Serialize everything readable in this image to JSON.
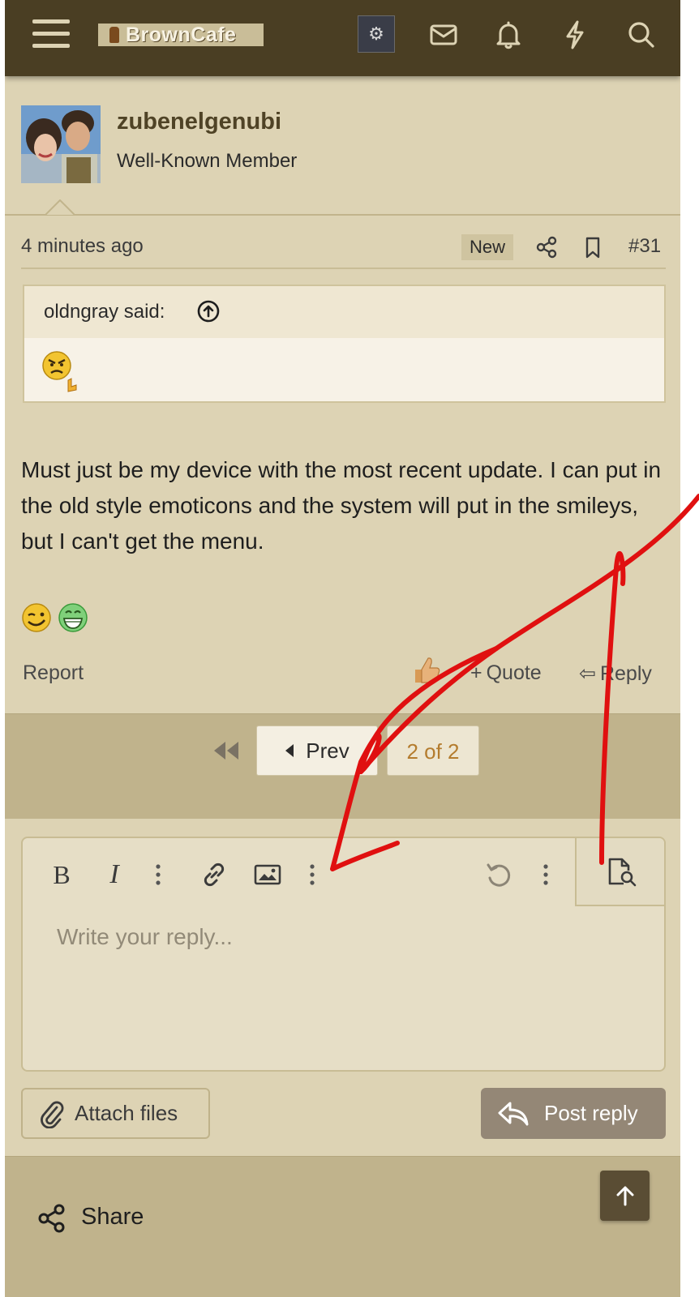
{
  "header": {
    "site_name": "BrownCafe",
    "icons": [
      "menu-icon",
      "inbox-icon",
      "bell-icon",
      "lightning-icon",
      "search-icon"
    ]
  },
  "post": {
    "username": "zubenelgenubi",
    "user_title": "Well-Known Member",
    "time": "4 minutes ago",
    "new_badge": "New",
    "post_number": "#31",
    "quote": {
      "author": "oldngray said:"
    },
    "body": "Must just be my device with the most recent update. I can put in the old style emoticons and the system will put in the smileys, but I can't get the menu.",
    "actions": {
      "report": "Report",
      "quote": "Quote",
      "reply": "Reply"
    }
  },
  "pagination": {
    "prev": "Prev",
    "current": "2 of 2"
  },
  "editor": {
    "placeholder": "Write your reply...",
    "bold": "B",
    "italic": "I",
    "attach": "Attach files",
    "post_reply": "Post reply"
  },
  "footer": {
    "share": "Share"
  },
  "colors": {
    "header_bg": "#4a3e23",
    "page_bg": "#ddd3b4",
    "band_bg": "#c0b38c",
    "accent_text": "#b47c2e",
    "annotation_red": "#e01010"
  }
}
